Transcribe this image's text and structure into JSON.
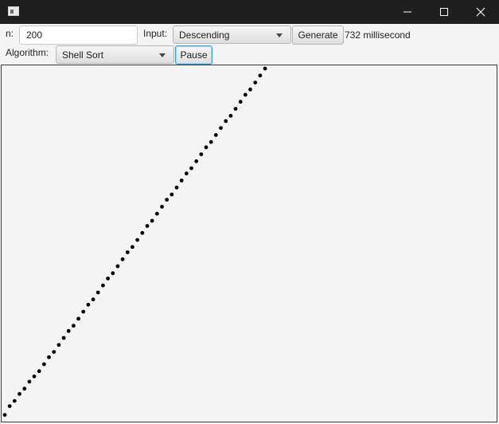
{
  "window": {
    "icons": {
      "app": "app-icon",
      "minimize": "minimize-icon",
      "maximize": "maximize-icon",
      "close": "close-icon"
    }
  },
  "controls": {
    "n_label": "n:",
    "n_value": "200",
    "input_label": "Input:",
    "input_selected": "Descending",
    "generate_label": "Generate",
    "time_text": "732 millisecond",
    "algorithm_label": "Algorithm:",
    "algorithm_selected": "Shell Sort",
    "pause_label": "Pause"
  },
  "visualization": {
    "n": 200,
    "point_color": "#000000",
    "background": "#f4f4f4",
    "index_value_pairs": [
      [
        0,
        2
      ],
      [
        2,
        7
      ],
      [
        4,
        10
      ],
      [
        6,
        14
      ],
      [
        8,
        17
      ],
      [
        10,
        21
      ],
      [
        12,
        24
      ],
      [
        14,
        27
      ],
      [
        16,
        31
      ],
      [
        18,
        35
      ],
      [
        20,
        38
      ],
      [
        22,
        42
      ],
      [
        24,
        46
      ],
      [
        26,
        50
      ],
      [
        28,
        53
      ],
      [
        30,
        57
      ],
      [
        32,
        61
      ],
      [
        34,
        65
      ],
      [
        36,
        68
      ],
      [
        38,
        72
      ],
      [
        40,
        76
      ],
      [
        42,
        80
      ],
      [
        44,
        83
      ],
      [
        46,
        87
      ],
      [
        48,
        91
      ],
      [
        50,
        95
      ],
      [
        52,
        98
      ],
      [
        54,
        102
      ],
      [
        56,
        106
      ],
      [
        58,
        110
      ],
      [
        60,
        113
      ],
      [
        62,
        117
      ],
      [
        64,
        121
      ],
      [
        66,
        125
      ],
      [
        68,
        128
      ],
      [
        70,
        132
      ],
      [
        72,
        136
      ],
      [
        74,
        140
      ],
      [
        76,
        143
      ],
      [
        78,
        147
      ],
      [
        80,
        151
      ],
      [
        82,
        155
      ],
      [
        84,
        158
      ],
      [
        86,
        162
      ],
      [
        88,
        166
      ],
      [
        90,
        170
      ],
      [
        92,
        173
      ],
      [
        94,
        177
      ],
      [
        96,
        181
      ],
      [
        98,
        185
      ],
      [
        100,
        188
      ],
      [
        102,
        192
      ],
      [
        104,
        196
      ],
      [
        106,
        200
      ],
      [
        108,
        203
      ],
      [
        110,
        207
      ],
      [
        112,
        211
      ],
      [
        114,
        214
      ],
      [
        116,
        217
      ],
      [
        118,
        220
      ],
      [
        120,
        223
      ],
      [
        122,
        226
      ],
      [
        124,
        229
      ],
      [
        126,
        232
      ],
      [
        128,
        235
      ],
      [
        130,
        238
      ],
      [
        132,
        241
      ],
      [
        134,
        244
      ],
      [
        136,
        247
      ],
      [
        138,
        250
      ],
      [
        140,
        253
      ],
      [
        142,
        256
      ],
      [
        144,
        259
      ],
      [
        146,
        262
      ],
      [
        148,
        265
      ],
      [
        150,
        268
      ],
      [
        152,
        271
      ],
      [
        154,
        274
      ],
      [
        156,
        277
      ],
      [
        158,
        280
      ],
      [
        160,
        283
      ],
      [
        162,
        286
      ],
      [
        164,
        289
      ],
      [
        166,
        292
      ],
      [
        168,
        295
      ],
      [
        170,
        298
      ],
      [
        172,
        301
      ],
      [
        174,
        304
      ],
      [
        176,
        307
      ],
      [
        178,
        310
      ],
      [
        180,
        313
      ],
      [
        182,
        316
      ],
      [
        184,
        319
      ],
      [
        186,
        322
      ],
      [
        188,
        325
      ],
      [
        190,
        328
      ],
      [
        192,
        331
      ],
      [
        194,
        334
      ],
      [
        196,
        337
      ],
      [
        198,
        340
      ]
    ]
  }
}
